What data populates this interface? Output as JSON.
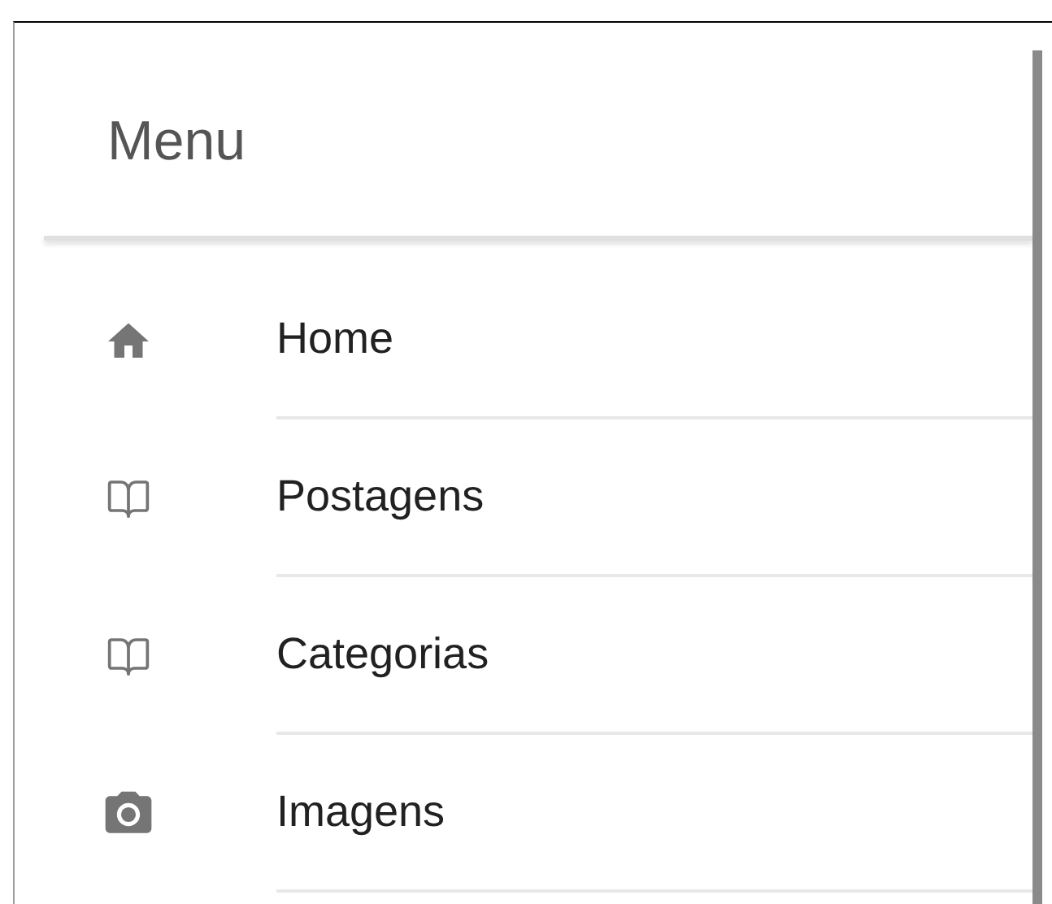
{
  "header": {
    "title": "Menu"
  },
  "menu_items": [
    {
      "label": "Home",
      "kind": "home"
    },
    {
      "label": "Postagens",
      "kind": "book"
    },
    {
      "label": "Categorias",
      "kind": "book"
    },
    {
      "label": "Imagens",
      "kind": "camera"
    }
  ]
}
